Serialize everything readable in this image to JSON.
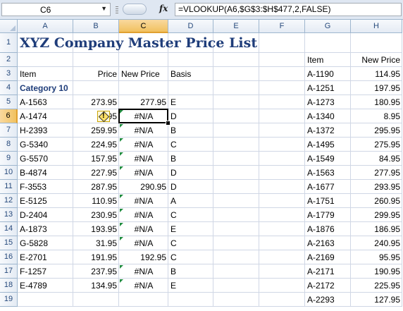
{
  "formula_bar": {
    "name_box": "C6",
    "fx_label": "fx",
    "formula": "=VLOOKUP(A6,$G$3:$H$477,2,FALSE)"
  },
  "columns": [
    "A",
    "B",
    "C",
    "D",
    "E",
    "F",
    "G",
    "H"
  ],
  "rows": [
    "1",
    "2",
    "3",
    "4",
    "5",
    "6",
    "7",
    "8",
    "9",
    "10",
    "11",
    "12",
    "13",
    "14",
    "15",
    "16",
    "17",
    "18",
    "19"
  ],
  "sheet": {
    "title": "XYZ Company Master Price List",
    "headers": {
      "item": "Item",
      "price": "Price",
      "new_price": "New Price",
      "basis": "Basis"
    },
    "category": "Category 10",
    "items": [
      {
        "item": "A-1563",
        "price": "273.95",
        "new_price": "277.95",
        "basis": "E"
      },
      {
        "item": "A-1474",
        "price": "95",
        "new_price": "#N/A",
        "basis": "D"
      },
      {
        "item": "H-2393",
        "price": "259.95",
        "new_price": "#N/A",
        "basis": "B"
      },
      {
        "item": "G-5340",
        "price": "224.95",
        "new_price": "#N/A",
        "basis": "C"
      },
      {
        "item": "G-5570",
        "price": "157.95",
        "new_price": "#N/A",
        "basis": "B"
      },
      {
        "item": "B-4874",
        "price": "227.95",
        "new_price": "#N/A",
        "basis": "D"
      },
      {
        "item": "F-3553",
        "price": "287.95",
        "new_price": "290.95",
        "basis": "D"
      },
      {
        "item": "E-5125",
        "price": "110.95",
        "new_price": "#N/A",
        "basis": "A"
      },
      {
        "item": "D-2404",
        "price": "230.95",
        "new_price": "#N/A",
        "basis": "C"
      },
      {
        "item": "A-1873",
        "price": "193.95",
        "new_price": "#N/A",
        "basis": "E"
      },
      {
        "item": "G-5828",
        "price": "31.95",
        "new_price": "#N/A",
        "basis": "C"
      },
      {
        "item": "E-2701",
        "price": "191.95",
        "new_price": "192.95",
        "basis": "C"
      },
      {
        "item": "F-1257",
        "price": "237.95",
        "new_price": "#N/A",
        "basis": "B"
      },
      {
        "item": "E-4789",
        "price": "134.95",
        "new_price": "#N/A",
        "basis": "E"
      }
    ],
    "lookup_headers": {
      "item": "Item",
      "new_price": "New Price"
    },
    "lookup": [
      {
        "item": "A-1190",
        "new_price": "114.95"
      },
      {
        "item": "A-1251",
        "new_price": "197.95"
      },
      {
        "item": "A-1273",
        "new_price": "180.95"
      },
      {
        "item": "A-1340",
        "new_price": "8.95"
      },
      {
        "item": "A-1372",
        "new_price": "295.95"
      },
      {
        "item": "A-1495",
        "new_price": "275.95"
      },
      {
        "item": "A-1549",
        "new_price": "84.95"
      },
      {
        "item": "A-1563",
        "new_price": "277.95"
      },
      {
        "item": "A-1677",
        "new_price": "293.95"
      },
      {
        "item": "A-1751",
        "new_price": "260.95"
      },
      {
        "item": "A-1779",
        "new_price": "299.95"
      },
      {
        "item": "A-1876",
        "new_price": "186.95"
      },
      {
        "item": "A-2163",
        "new_price": "240.95"
      },
      {
        "item": "A-2169",
        "new_price": "95.95"
      },
      {
        "item": "A-2171",
        "new_price": "190.95"
      },
      {
        "item": "A-2172",
        "new_price": "225.95"
      },
      {
        "item": "A-2293",
        "new_price": "127.95"
      }
    ]
  },
  "selection": {
    "column": "C",
    "row": "6"
  },
  "colors": {
    "title": "#1f3d7a",
    "error_triangle": "#1e8b3e",
    "header_selected": "#f1c15f"
  },
  "icons": {
    "fx": "function-icon",
    "warning": "error-warning-icon"
  }
}
